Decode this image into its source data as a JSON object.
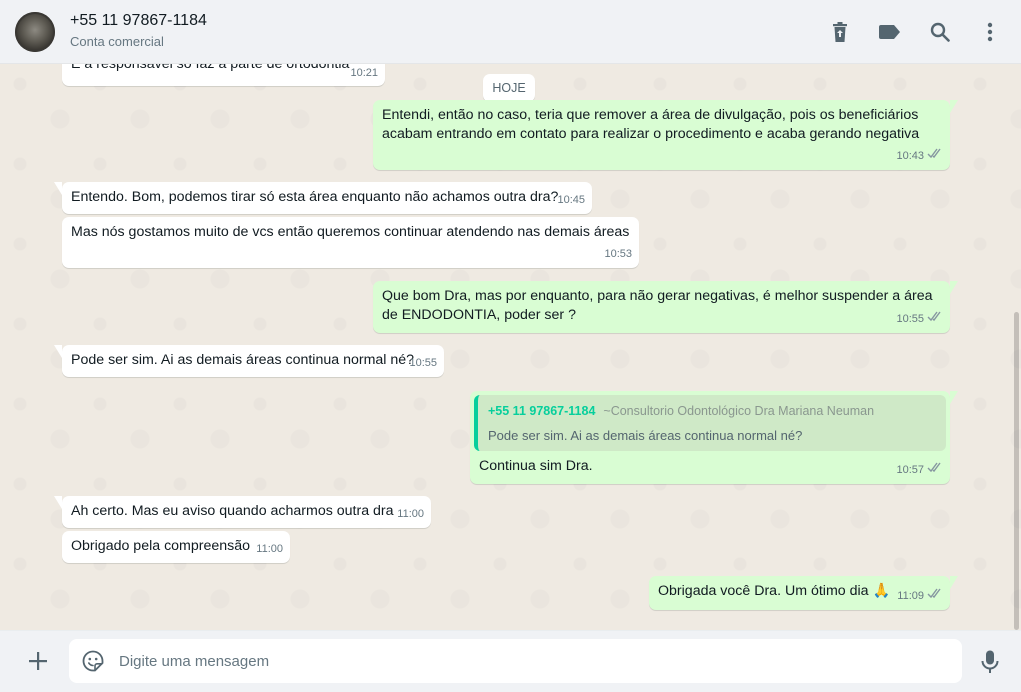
{
  "header": {
    "contact_name": "+55 11 97867-1184",
    "contact_subtitle": "Conta comercial",
    "icons": [
      "delete-icon",
      "label-icon",
      "search-icon",
      "more-icon"
    ]
  },
  "chat": {
    "date_divider": "HOJE",
    "messages": [
      {
        "dir": "in",
        "text": "E a responsável só faz a parte de ortodontia",
        "time": "10:21"
      },
      {
        "dir": "out",
        "text": "Entendi, então no caso, teria que remover a área de divulgação, pois os beneficiários acabam entrando em contato para realizar o procedimento e acaba gerando negativa",
        "time": "10:43",
        "status": "read"
      },
      {
        "dir": "in",
        "text": "Entendo. Bom, podemos tirar só esta área enquanto não achamos outra dra?",
        "time": "10:45"
      },
      {
        "dir": "in",
        "text": "Mas nós gostamos muito de vcs então queremos continuar atendendo nas demais áreas",
        "time": "10:53"
      },
      {
        "dir": "out",
        "text": "Que bom Dra, mas por enquanto, para não gerar negativas, é melhor suspender a área de ENDODONTIA, poder ser ?",
        "time": "10:55",
        "status": "read"
      },
      {
        "dir": "in",
        "text": "Pode ser sim. Ai as demais áreas continua normal né?",
        "time": "10:55"
      },
      {
        "dir": "out",
        "text": "Continua sim Dra.",
        "time": "10:57",
        "status": "read",
        "quote": {
          "author": "+55 11 97867-1184",
          "pushname": "~Consultorio Odontológico Dra Mariana Neuman",
          "text": "Pode ser sim. Ai as demais áreas continua normal né?"
        }
      },
      {
        "dir": "in",
        "text": "Ah certo. Mas eu aviso quando acharmos outra dra",
        "time": "11:00"
      },
      {
        "dir": "in",
        "text": "Obrigado pela compreensão",
        "time": "11:00"
      },
      {
        "dir": "out",
        "text": "Obrigada você Dra. Um ótimo dia 🙏",
        "time": "11:09",
        "status": "read"
      }
    ]
  },
  "composer": {
    "placeholder": "Digite uma mensagem"
  },
  "colors": {
    "incoming_bubble": "#ffffff",
    "outgoing_bubble": "#d9fdd3",
    "chat_background": "#efeae2",
    "read_check": "#53bdeb",
    "quote_accent": "#06cf9c"
  }
}
